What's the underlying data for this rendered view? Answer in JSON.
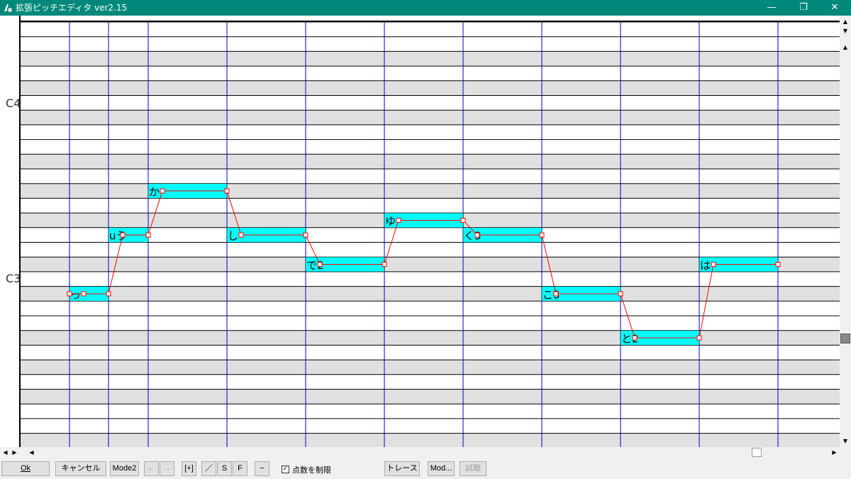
{
  "window": {
    "title": "拡張ピッチエディタ ver2.15",
    "min_glyph": "—",
    "max_glyph": "❐",
    "close_glyph": "✕"
  },
  "pitch_labels": [
    "C4",
    "C3"
  ],
  "notes": [
    {
      "label": "っ",
      "seg": 0,
      "row": 18
    },
    {
      "label": "uう",
      "seg": 1,
      "row": 14
    },
    {
      "label": "か",
      "seg": 2,
      "row": 11
    },
    {
      "label": "し",
      "seg": 3,
      "row": 14
    },
    {
      "label": "で2",
      "seg": 4,
      "row": 16
    },
    {
      "label": "ゆ",
      "seg": 5,
      "row": 13
    },
    {
      "label": "く3",
      "seg": 6,
      "row": 14
    },
    {
      "label": "こ3",
      "seg": 7,
      "row": 18
    },
    {
      "label": "と2",
      "seg": 8,
      "row": 21
    },
    {
      "label": "は",
      "seg": 9,
      "row": 16
    }
  ],
  "toolbar": {
    "ok": "Ok",
    "cancel": "キャンセル",
    "mode2": "Mode2",
    "left_arrow": "←",
    "right_arrow": "→",
    "plus_bracket": "[+]",
    "slash": "／",
    "s": "S",
    "f": "F",
    "minus": "−",
    "limit_points_checked": true,
    "limit_points_label": "点数を制限",
    "trace": "トレース",
    "mod": "Mod...",
    "listen": "試聴"
  },
  "colors": {
    "titlebar": "#00897b",
    "note": "#00ffff",
    "beat_line": "#0000cc",
    "pitch_curve": "#ff0000",
    "row_gray": "#e0e0e0"
  }
}
